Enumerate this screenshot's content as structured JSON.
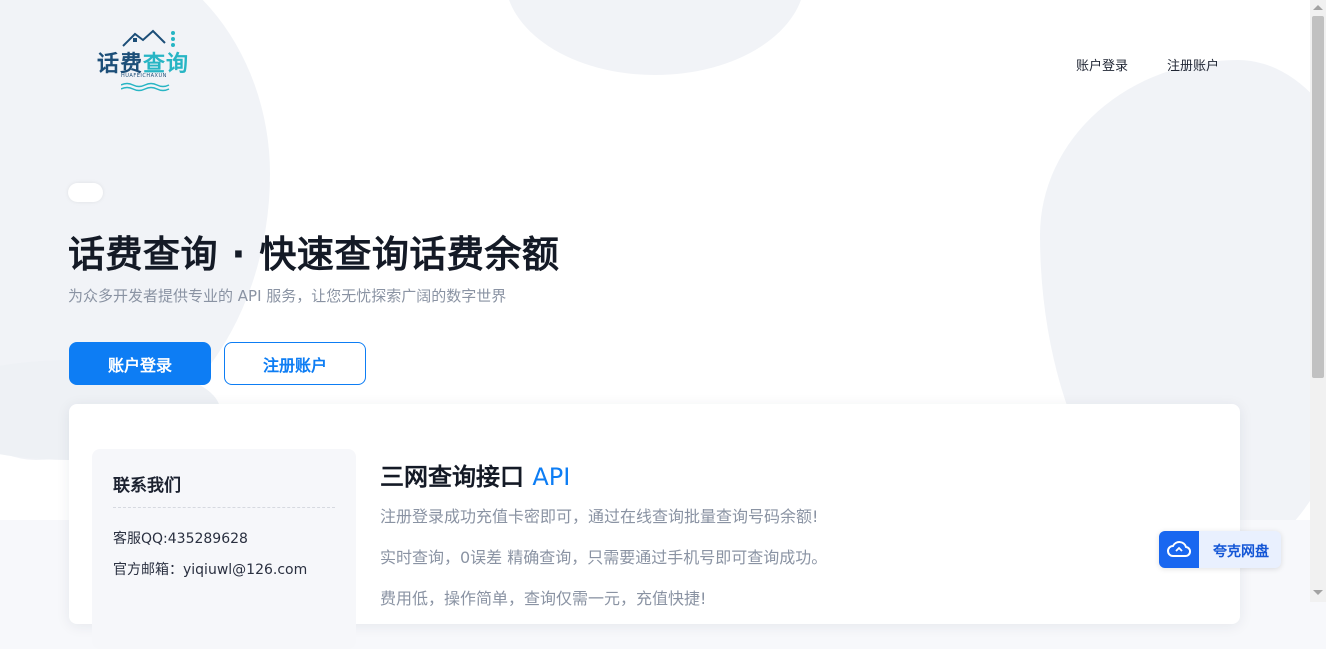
{
  "brand": {
    "logo_text_main": "话费",
    "logo_text_accent": "查询",
    "logo_subtext": "HUAFEICHAXUN"
  },
  "nav": {
    "login": "账户登录",
    "register": "注册账户"
  },
  "hero": {
    "headline": "话费查询 · 快速查询话费余额",
    "subline": "为众多开发者提供专业的 API 服务，让您无忧探索广阔的数字世界",
    "primary_button": "账户登录",
    "secondary_button": "注册账户"
  },
  "contact": {
    "title": "联系我们",
    "qq": "客服QQ:435289628",
    "email": "官方邮箱：yiqiuwl@126.com"
  },
  "api": {
    "title": "三网查询接口",
    "title_accent": "API",
    "lines": [
      "注册登录成功充值卡密即可，通过在线查询批量查询号码余额!",
      "实时查询，0误差 精确查询，只需要通过手机号即可查询成功。",
      "费用低，操作简单，查询仅需一元，充值快捷!"
    ]
  },
  "floating": {
    "quark_label": "夸克网盘",
    "quark_icon": "cloud-icon"
  },
  "colors": {
    "accent": "#0d7df4",
    "logo_dark": "#1c4e78",
    "logo_teal": "#27b5c4"
  }
}
